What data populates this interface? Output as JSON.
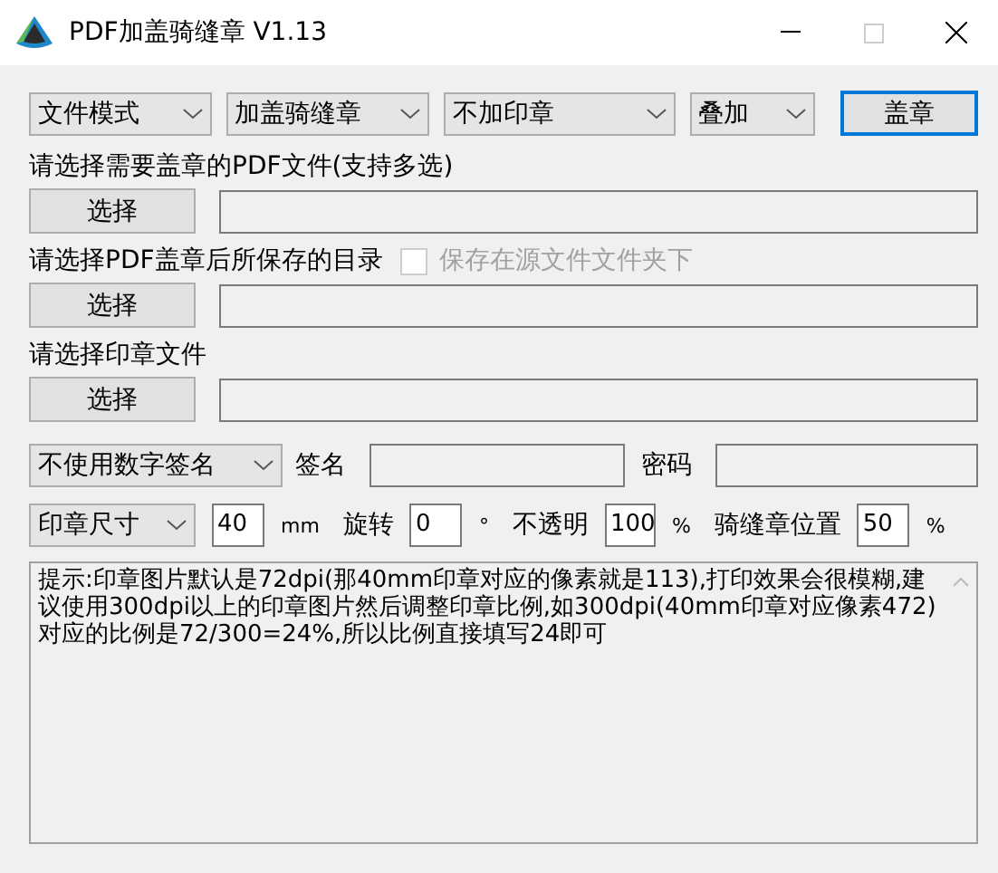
{
  "window": {
    "title": "PDF加盖骑缝章 V1.13"
  },
  "toolbar": {
    "dropdowns": [
      {
        "value": "文件模式"
      },
      {
        "value": "加盖骑缝章"
      },
      {
        "value": "不加印章"
      },
      {
        "value": "叠加"
      }
    ],
    "stamp_button": "盖章"
  },
  "sections": [
    {
      "label": "请选择需要盖章的PDF文件(支持多选)",
      "button": "选择"
    },
    {
      "label": "请选择PDF盖章后所保存的目录",
      "checkbox": {
        "label": "保存在源文件文件夹下",
        "checked": false,
        "disabled": true
      },
      "button": "选择"
    },
    {
      "label": "请选择印章文件",
      "button": "选择"
    }
  ],
  "signature": {
    "dropdown": "不使用数字签名",
    "name_label": "签名",
    "password_label": "密码"
  },
  "params": [
    {
      "kind": "dropdown",
      "text": "印章尺寸"
    },
    {
      "kind": "input",
      "text": "40"
    },
    {
      "kind": "unit",
      "text": "mm"
    },
    {
      "kind": "label",
      "text": "旋转"
    },
    {
      "kind": "input",
      "text": "0"
    },
    {
      "kind": "unit",
      "text": "°"
    },
    {
      "kind": "label",
      "text": "不透明"
    },
    {
      "kind": "input",
      "text": "100"
    },
    {
      "kind": "unit",
      "text": "%"
    },
    {
      "kind": "label",
      "text": "骑缝章位置"
    },
    {
      "kind": "input",
      "text": "50"
    },
    {
      "kind": "unit",
      "text": "%"
    }
  ],
  "hint": "提示:印章图片默认是72dpi(那40mm印章对应的像素就是113),打印效果会很模糊,建议使用300dpi以上的印章图片然后调整印章比例,如300dpi(40mm印章对应像素472)对应的比例是72/300=24%,所以比例直接填写24即可"
}
